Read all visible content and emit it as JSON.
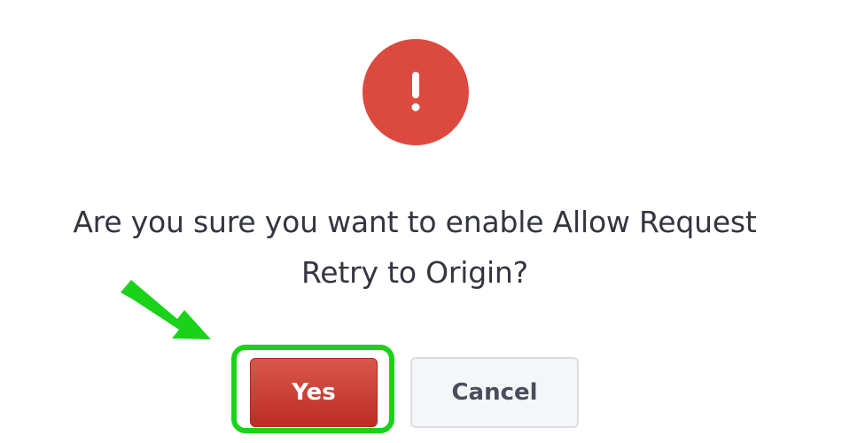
{
  "dialog": {
    "icon": "exclamation-icon",
    "icon_glyph": "!",
    "message": "Are you sure you want to enable Allow Request Retry to Origin?",
    "confirm_label": "Yes",
    "cancel_label": "Cancel"
  },
  "annotation": {
    "pointer": "arrow-pointer-icon",
    "highlight_color": "#19d219"
  },
  "colors": {
    "danger": "#dc4a3f",
    "confirm_button": "#c8372f",
    "cancel_button": "#f5f6f8",
    "text": "#333541"
  }
}
